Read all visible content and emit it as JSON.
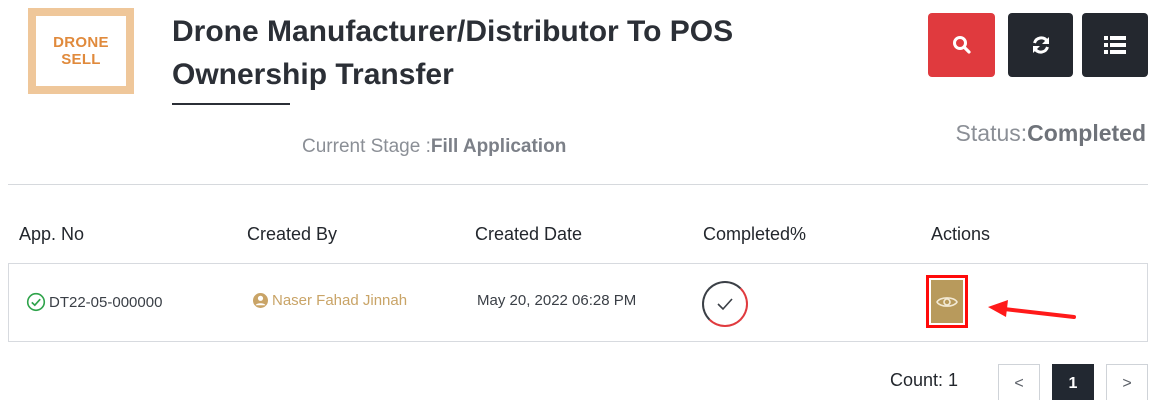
{
  "logo": {
    "line1": "DRONE",
    "line2": "SELL"
  },
  "header": {
    "title": "Drone Manufacturer/Distributor To POS Ownership Transfer",
    "accent_color": "#e03a3e",
    "dark_color": "#24282f"
  },
  "toolbar": {
    "search_icon": "search-icon",
    "refresh_icon": "refresh-icon",
    "list_icon": "list-icon"
  },
  "stage": {
    "label": "Current Stage :",
    "value": "Fill Application"
  },
  "status": {
    "label": "Status:",
    "value": "Completed"
  },
  "table": {
    "headers": [
      "App. No",
      "Created By",
      "Created Date",
      "Completed%",
      "Actions"
    ],
    "rows": [
      {
        "app_no": "DT22-05-000000",
        "created_by": "Naser Fahad Jinnah",
        "created_date": "May 20, 2022 06:28 PM",
        "completed_icon": "checkmark-icon",
        "action_icon": "eye-icon"
      }
    ]
  },
  "pagination": {
    "count_label": "Count: 1",
    "prev": "<",
    "current": "1",
    "next": ">"
  }
}
